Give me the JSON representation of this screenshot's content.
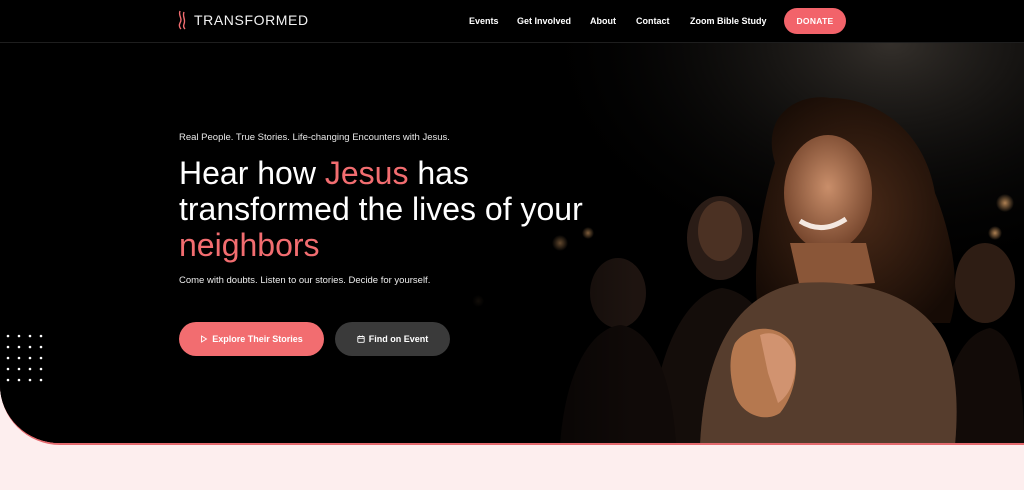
{
  "brand": {
    "name": "TRANSFORMED",
    "logo_icon": "flame-logo-icon"
  },
  "nav": {
    "events": "Events",
    "get_involved": "Get Involved",
    "about": "About",
    "contact": "Contact",
    "zoom": "Zoom Bible Study",
    "donate": "DONATE"
  },
  "hero": {
    "tagline": "Real People. True Stories. Life-changing Encounters with Jesus.",
    "headline": {
      "part1": "Hear how ",
      "accent1": "Jesus",
      "part2": " has transformed the lives of your ",
      "accent2": "neighbors"
    },
    "subline": "Come with doubts. Listen to our stories. Decide for yourself.",
    "cta_primary": {
      "label": "Explore Their Stories",
      "icon": "play-icon"
    },
    "cta_secondary": {
      "label": "Find on Event",
      "icon": "calendar-icon"
    }
  },
  "colors": {
    "accent": "#f26d70",
    "background": "#000000",
    "page": "#fdeeee",
    "secondary_button": "#3a3a3a"
  }
}
